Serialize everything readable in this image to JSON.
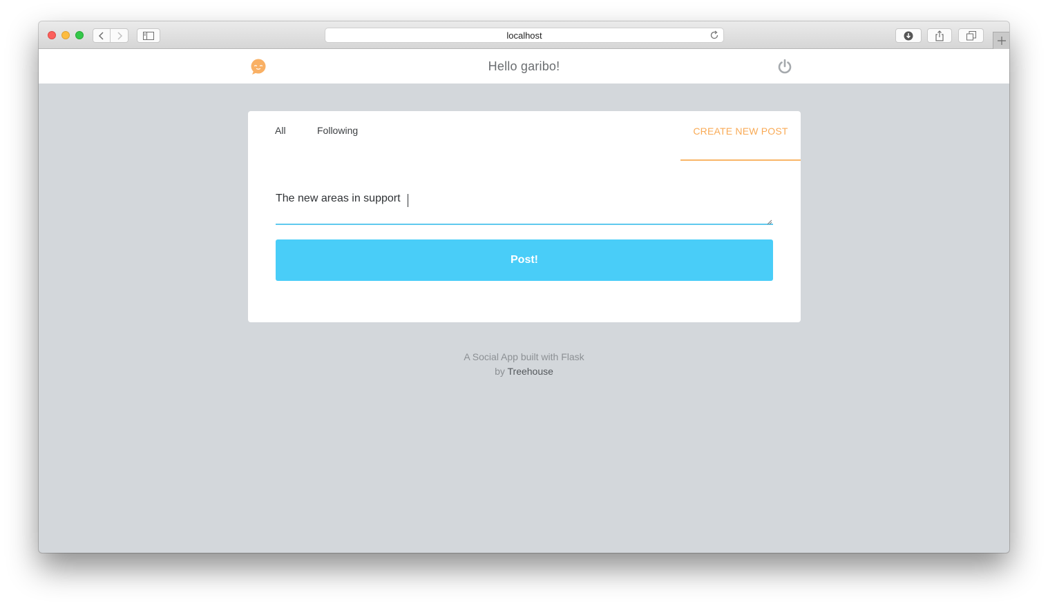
{
  "browser": {
    "url": "localhost",
    "icons": {
      "back": "chevron-left-icon",
      "forward": "chevron-right-icon",
      "sidebar": "sidebar-icon",
      "reload": "reload-icon",
      "download": "download-icon",
      "share": "share-icon",
      "tabs": "tabs-icon",
      "new_tab": "plus-icon"
    }
  },
  "header": {
    "greeting": "Hello garibo!",
    "logo_icon": "chat-face-logo-icon",
    "logout_icon": "power-icon"
  },
  "tabs": {
    "all": "All",
    "following": "Following",
    "create": "CREATE NEW POST"
  },
  "form": {
    "post_text": "The new areas in support",
    "submit_label": "Post!"
  },
  "footer": {
    "line1": "A Social App built with Flask",
    "by_prefix": "by",
    "by_link": "Treehouse"
  },
  "colors": {
    "accent_orange": "#f9aa55",
    "accent_blue": "#49cdf8",
    "page_background": "#d3d7db"
  }
}
